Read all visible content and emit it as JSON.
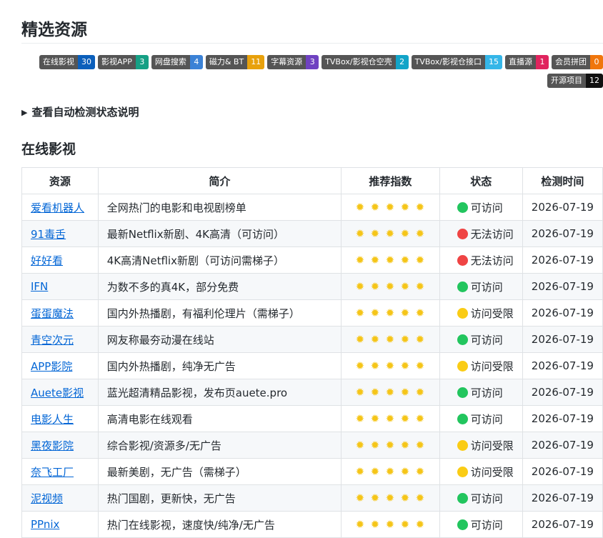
{
  "page": {
    "title": "精选资源"
  },
  "badges": [
    {
      "label": "在线影视",
      "count": "30",
      "color": "#0b5fbb"
    },
    {
      "label": "影视APP",
      "count": "3",
      "color": "#16a085"
    },
    {
      "label": "网盘搜索",
      "count": "4",
      "color": "#3b82d6"
    },
    {
      "label": "磁力& BT",
      "count": "11",
      "color": "#e8a10c"
    },
    {
      "label": "字幕资源",
      "count": "3",
      "color": "#6f42c1"
    },
    {
      "label": "TVBox/影视仓空壳",
      "count": "2",
      "color": "#12a4c8"
    },
    {
      "label": "TVBox/影视仓接口",
      "count": "15",
      "color": "#35b6e8"
    },
    {
      "label": "直播源",
      "count": "1",
      "color": "#e0245e"
    },
    {
      "label": "会员拼团",
      "count": "0",
      "color": "#f0760c"
    },
    {
      "label": "开源项目",
      "count": "12",
      "color": "#111111"
    }
  ],
  "details": {
    "label": "查看自动检测状态说明"
  },
  "section": {
    "title": "在线影视"
  },
  "table": {
    "headers": [
      "资源",
      "简介",
      "推荐指数",
      "状态",
      "检测时间"
    ],
    "star_icon": "sun-icon",
    "rows": [
      {
        "name": "爱看机器人",
        "desc": "全网热门的电影和电视剧榜单",
        "stars": 5,
        "status": "可访问",
        "status_type": "ok",
        "date": "2026-07-19"
      },
      {
        "name": "91毒舌",
        "desc": "最新Netflix新剧、4K高清（可访问）",
        "stars": 5,
        "status": "无法访问",
        "status_type": "bad",
        "date": "2026-07-19"
      },
      {
        "name": "好好看",
        "desc": "4K高清Netflix新剧（可访问需梯子）",
        "stars": 5,
        "status": "无法访问",
        "status_type": "bad",
        "date": "2026-07-19"
      },
      {
        "name": "IFN",
        "desc": "为数不多的真4K，部分免费",
        "stars": 5,
        "status": "可访问",
        "status_type": "ok",
        "date": "2026-07-19"
      },
      {
        "name": "蛋蛋魔法",
        "desc": "国内外热播剧，有福利伦理片（需梯子）",
        "stars": 5,
        "status": "访问受限",
        "status_type": "limit",
        "date": "2026-07-19"
      },
      {
        "name": "青空次元",
        "desc": "网友称最夯动漫在线站",
        "stars": 5,
        "status": "可访问",
        "status_type": "ok",
        "date": "2026-07-19"
      },
      {
        "name": "APP影院",
        "desc": "国内外热播剧，纯净无广告",
        "stars": 5,
        "status": "访问受限",
        "status_type": "limit",
        "date": "2026-07-19"
      },
      {
        "name": "Auete影视",
        "desc": "蓝光超清精品影视，发布页auete.pro",
        "stars": 5,
        "status": "可访问",
        "status_type": "ok",
        "date": "2026-07-19"
      },
      {
        "name": "电影人生",
        "desc": "高清电影在线观看",
        "stars": 5,
        "status": "可访问",
        "status_type": "ok",
        "date": "2026-07-19"
      },
      {
        "name": "黑夜影院",
        "desc": "综合影视/资源多/无广告",
        "stars": 5,
        "status": "访问受限",
        "status_type": "limit",
        "date": "2026-07-19"
      },
      {
        "name": "奈飞工厂",
        "desc": "最新美剧，无广告（需梯子）",
        "stars": 5,
        "status": "访问受限",
        "status_type": "limit",
        "date": "2026-07-19"
      },
      {
        "name": "泥视频",
        "desc": "热门国剧，更新快，无广告",
        "stars": 5,
        "status": "可访问",
        "status_type": "ok",
        "date": "2026-07-19"
      },
      {
        "name": "PPnix",
        "desc": "热门在线影视，速度快/纯净/无广告",
        "stars": 5,
        "status": "可访问",
        "status_type": "ok",
        "date": "2026-07-19"
      }
    ]
  }
}
